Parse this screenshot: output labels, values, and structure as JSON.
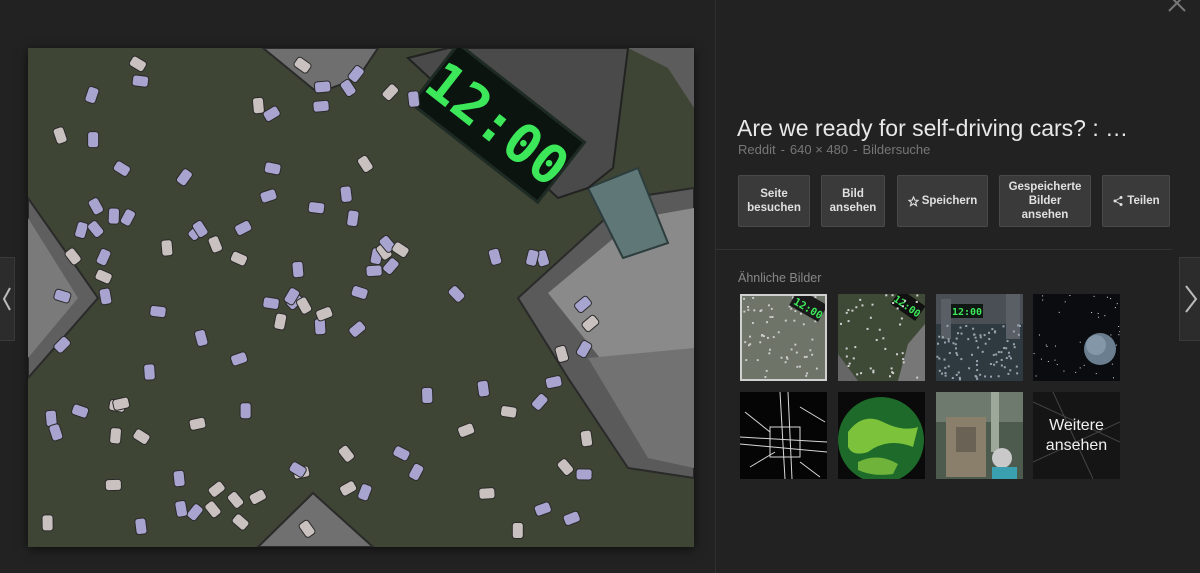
{
  "detail": {
    "title": "Are we ready for self-driving cars? : …",
    "source": "Reddit",
    "dimensions": "640 × 480",
    "search_link": "Bildersuche",
    "separator": "-"
  },
  "actions": {
    "visit_page": "Seite\nbesuchen",
    "view_image": "Bild\nansehen",
    "save": "Speichern",
    "view_saved": "Gespeicherte\nBilder\nansehen",
    "share": "Teilen"
  },
  "similar": {
    "label": "Ähnliche Bilder",
    "more_label": "Weitere\nansehen"
  },
  "main_image": {
    "clock_text": "12:00"
  },
  "thumbnails": {
    "clock_small": "12:00"
  },
  "colors": {
    "background": "#222222",
    "button_bg": "#3a3a3a",
    "clock_green": "#3ce85a",
    "title_text": "#e8e8e8",
    "meta_text": "#777777"
  },
  "icons": {
    "nav_prev": "chevron-left-icon",
    "nav_next": "chevron-right-icon",
    "close": "close-icon",
    "star": "star-icon",
    "share": "share-icon"
  }
}
